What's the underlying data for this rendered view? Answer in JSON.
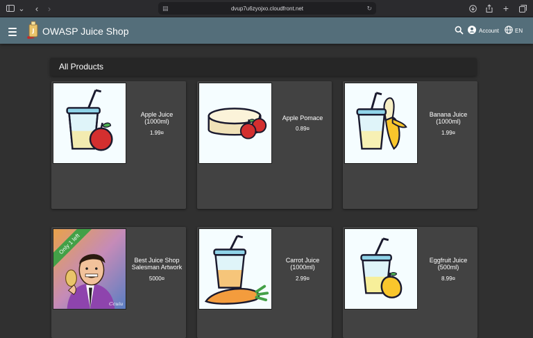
{
  "browser": {
    "url": "dvup7u6zyojxo.cloudfront.net"
  },
  "toolbar": {
    "title": "OWASP Juice Shop",
    "account_label": "Account",
    "language_label": "EN"
  },
  "main": {
    "heading": "All Products"
  },
  "products": [
    {
      "name": "Apple Juice (1000ml)",
      "price": "1.99¤",
      "image": "apple-juice-image"
    },
    {
      "name": "Apple Pomace",
      "price": "0.89¤",
      "image": "apple-pomace-image"
    },
    {
      "name": "Banana Juice (1000ml)",
      "price": "1.99¤",
      "image": "banana-juice-image"
    },
    {
      "name": "Best Juice Shop Salesman Artwork",
      "price": "5000¤",
      "image": "salesman-artwork-image",
      "badge": "Only 1 left"
    },
    {
      "name": "Carrot Juice (1000ml)",
      "price": "2.99¤",
      "image": "carrot-juice-image"
    },
    {
      "name": "Eggfruit Juice (500ml)",
      "price": "8.99¤",
      "image": "eggfruit-juice-image"
    }
  ],
  "colors": {
    "toolbar": "#546e7a",
    "background": "#303030",
    "card": "#424242",
    "badge": "#43a047"
  }
}
